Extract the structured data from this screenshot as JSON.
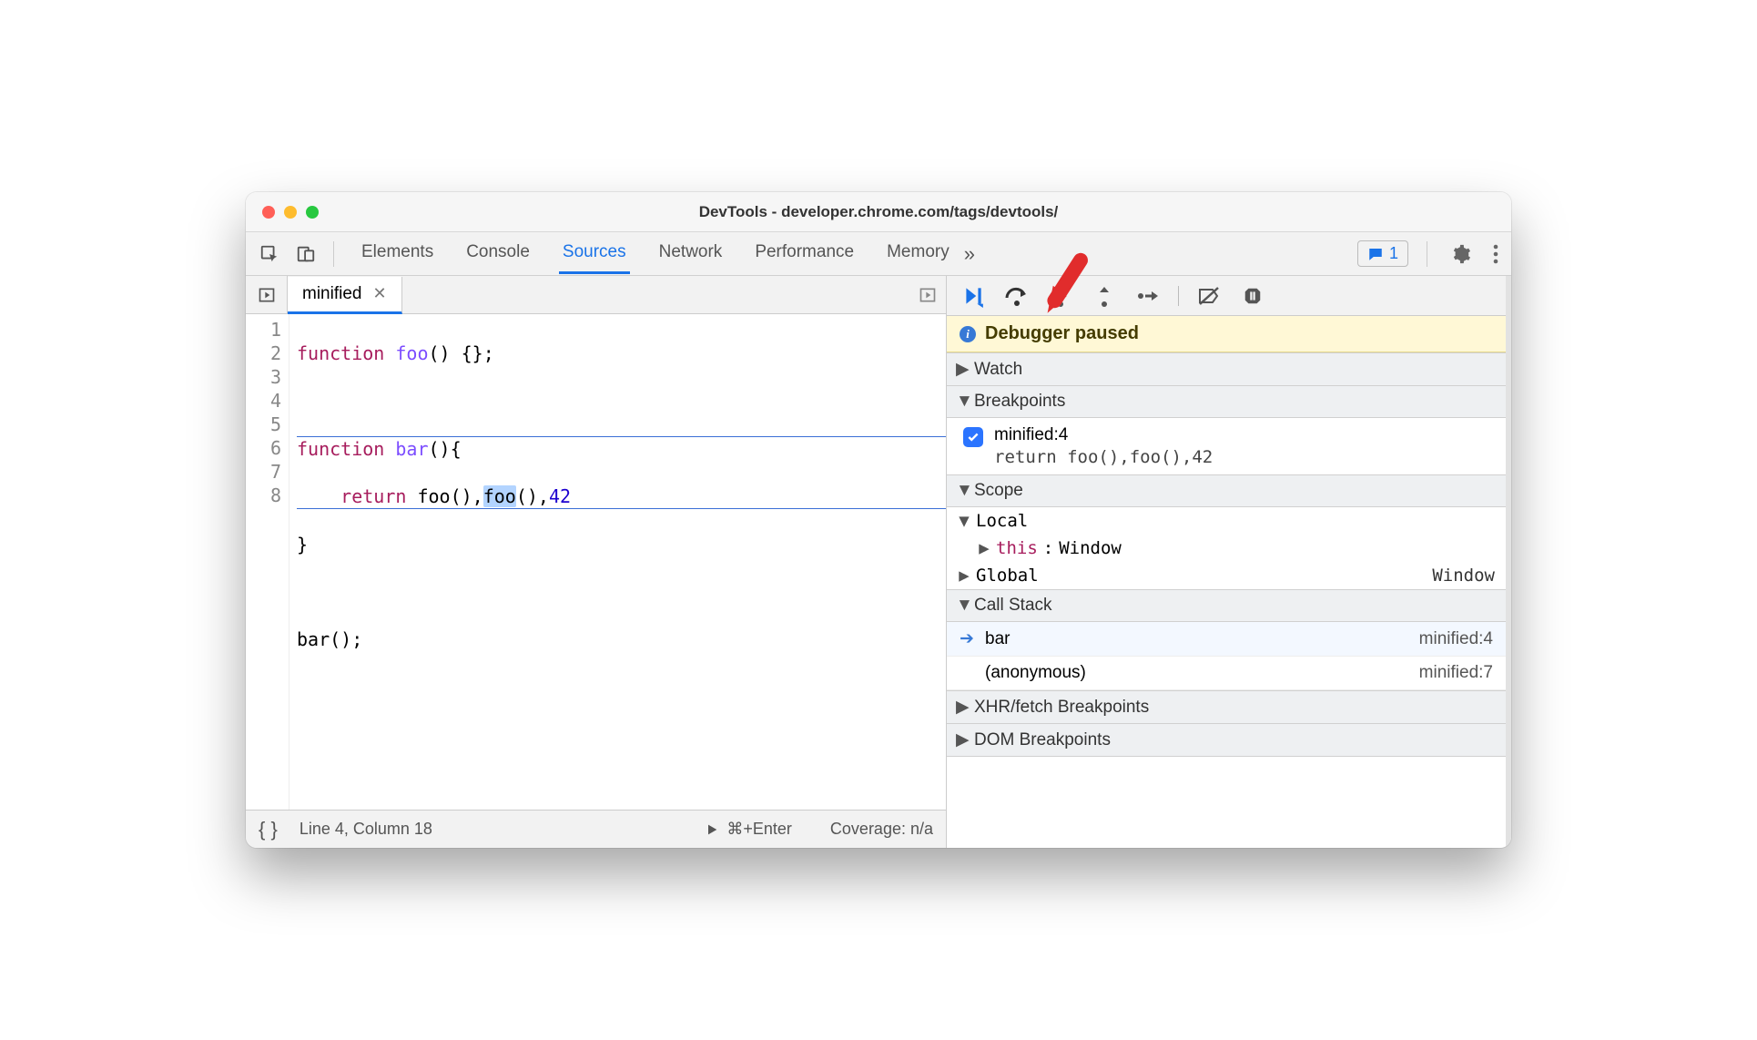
{
  "window": {
    "title": "DevTools - developer.chrome.com/tags/devtools/"
  },
  "tabs": {
    "elements": "Elements",
    "console": "Console",
    "sources": "Sources",
    "network": "Network",
    "performance": "Performance",
    "memory": "Memory"
  },
  "issues": {
    "count": "1"
  },
  "file_tab": {
    "name": "minified"
  },
  "editor": {
    "lines": {
      "l1": "1",
      "l2": "2",
      "l3": "3",
      "l4": "4",
      "l5": "5",
      "l6": "6",
      "l7": "7",
      "l8": "8"
    },
    "code": {
      "r1_kw": "function",
      "r1_fn": "foo",
      "r1_rest": "() {};",
      "r3_kw": "function",
      "r3_fn": "bar",
      "r3_rest": "(){",
      "r4_indent": "    ",
      "r4_kw": "return",
      "r4_sp": " ",
      "r4_c1": "foo",
      "r4_p1": "(),",
      "r4_c2": "foo",
      "r4_p2": "(),",
      "r4_num": "42",
      "r5": "}",
      "r7_fn": "bar",
      "r7_rest": "();"
    }
  },
  "status": {
    "pos": "Line 4, Column 18",
    "runhint": "⌘+Enter",
    "coverage": "Coverage: n/a"
  },
  "debugger": {
    "paused_label": "Debugger paused",
    "watch": "Watch",
    "breakpoints": "Breakpoints",
    "bp_item_name": "minified:4",
    "bp_item_src": "return foo(),foo(),42",
    "scope": "Scope",
    "scope_local": "Local",
    "scope_this_label": "this",
    "scope_this_sep": ": ",
    "scope_this_val": "Window",
    "scope_global": "Global",
    "scope_global_val": "Window",
    "callstack": "Call Stack",
    "cs0_name": "bar",
    "cs0_loc": "minified:4",
    "cs1_name": "(anonymous)",
    "cs1_loc": "minified:7",
    "xhr": "XHR/fetch Breakpoints",
    "dom": "DOM Breakpoints"
  }
}
